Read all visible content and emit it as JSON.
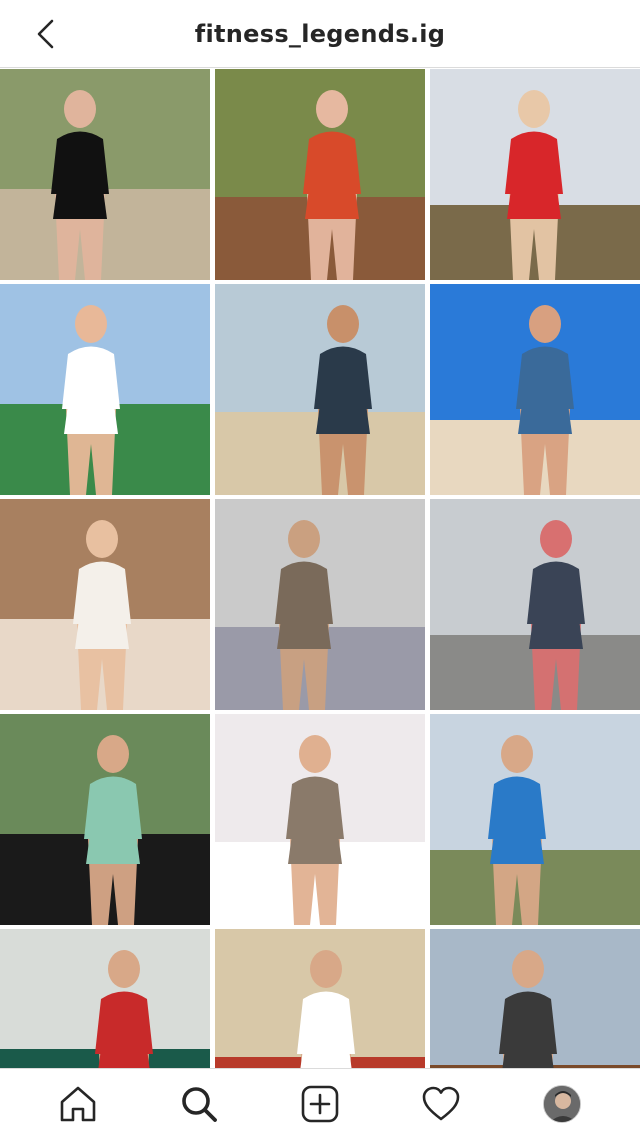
{
  "header": {
    "username": "fitness_legends.ig",
    "back_icon": "chevron-left-icon"
  },
  "grid": {
    "columns": 3,
    "rows": 5,
    "posts": [
      {
        "kind": "photo",
        "palette": [
          "#8a9a6a",
          "#c2b49a",
          "#111111",
          "#e0b49c"
        ]
      },
      {
        "kind": "photo",
        "palette": [
          "#7a8a4a",
          "#8a5a3a",
          "#d84a2a",
          "#e6b8a0"
        ]
      },
      {
        "kind": "photo",
        "palette": [
          "#d8dde4",
          "#7a6a4a",
          "#d8262a",
          "#e8c8a8"
        ]
      },
      {
        "kind": "photo",
        "palette": [
          "#9fc2e4",
          "#3a8a4a",
          "#ffffff",
          "#e8b898"
        ]
      },
      {
        "kind": "photo",
        "palette": [
          "#b8cad6",
          "#d8c8a8",
          "#2a3a4a",
          "#c8906a"
        ]
      },
      {
        "kind": "photo",
        "palette": [
          "#2a7ad8",
          "#e8d8c0",
          "#3a6a9a",
          "#d8a080"
        ]
      },
      {
        "kind": "photo",
        "palette": [
          "#a88060",
          "#e8d8c8",
          "#f4f0ea",
          "#e8c0a0"
        ]
      },
      {
        "kind": "photo",
        "palette": [
          "#cacaca",
          "#9a9aa8",
          "#7a6a5a",
          "#caa080"
        ]
      },
      {
        "kind": "photo",
        "palette": [
          "#c8ccd0",
          "#8a8a88",
          "#3a4456",
          "#d87070"
        ]
      },
      {
        "kind": "photo",
        "palette": [
          "#6a8a5a",
          "#1a1a1a",
          "#8ac8b0",
          "#d8a888"
        ]
      },
      {
        "kind": "photo",
        "palette": [
          "#eeeaec",
          "#ffffff",
          "#8a7a6a",
          "#e0b090"
        ]
      },
      {
        "kind": "photo",
        "palette": [
          "#c8d4e0",
          "#7a8a5a",
          "#2a7ac8",
          "#d8a888"
        ]
      },
      {
        "kind": "photo",
        "palette": [
          "#d8dcd8",
          "#1a5a4a",
          "#c82a2a",
          "#d8a888"
        ]
      },
      {
        "kind": "photo",
        "palette": [
          "#d8c8a8",
          "#b83a2a",
          "#ffffff",
          "#d8a888"
        ]
      },
      {
        "kind": "photo",
        "palette": [
          "#a8b8c8",
          "#7a4a2a",
          "#3a3a3a",
          "#d8a888"
        ]
      }
    ]
  },
  "tabbar": {
    "items": [
      {
        "name": "tab-home",
        "icon": "home-icon"
      },
      {
        "name": "tab-search",
        "icon": "search-icon"
      },
      {
        "name": "tab-create",
        "icon": "plus-square-icon"
      },
      {
        "name": "tab-activity",
        "icon": "heart-icon"
      },
      {
        "name": "tab-profile",
        "icon": "avatar"
      }
    ]
  }
}
